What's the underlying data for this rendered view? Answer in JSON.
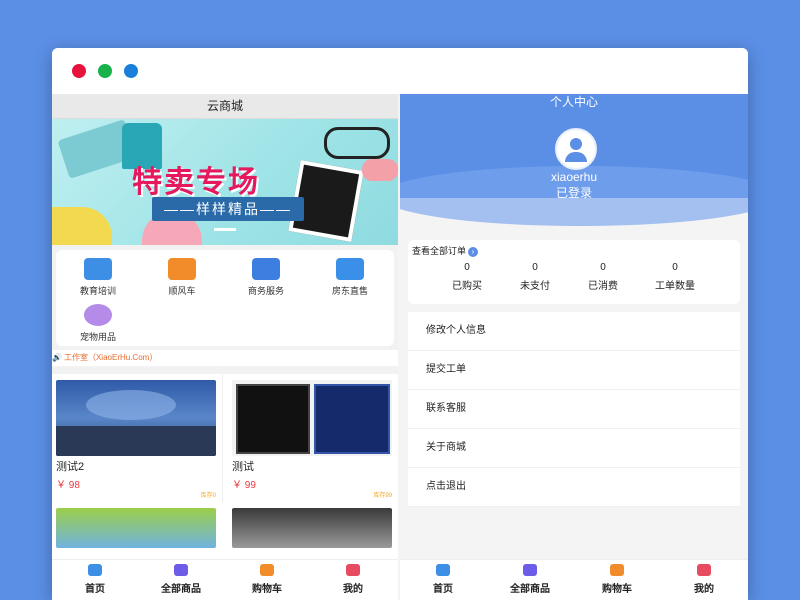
{
  "left": {
    "title": "云商城",
    "banner": {
      "title": "特卖专场",
      "subtitle": "——样样精品——"
    },
    "categories": [
      {
        "label": "教育培训",
        "icon": "education-icon",
        "color": "#3d8fe6"
      },
      {
        "label": "顺风车",
        "icon": "car-icon",
        "color": "#f28b2a"
      },
      {
        "label": "商务服务",
        "icon": "business-icon",
        "color": "#3d7fe0"
      },
      {
        "label": "房东直售",
        "icon": "house-icon",
        "color": "#3a8fe8"
      },
      {
        "label": "宠物用品",
        "icon": "paw-icon",
        "color": "#b48be8"
      }
    ],
    "notice": "工作室（XiaoErHu.Com）",
    "products": [
      {
        "name": "测试2",
        "price": "￥ 98",
        "stock": "库存0"
      },
      {
        "name": "测试",
        "price": "￥ 99",
        "stock": "库存99"
      }
    ]
  },
  "right": {
    "title": "个人中心",
    "username": "xiaoerhu",
    "status": "已登录",
    "orders_link": "查看全部订单",
    "stats": [
      {
        "value": "0",
        "label": "已购买"
      },
      {
        "value": "0",
        "label": "未支付"
      },
      {
        "value": "0",
        "label": "已消费"
      },
      {
        "value": "0",
        "label": "工单数量"
      }
    ],
    "menu": [
      "修改个人信息",
      "提交工单",
      "联系客服",
      "关于商城",
      "点击退出"
    ]
  },
  "tabs": [
    {
      "label": "首页",
      "icon": "home-icon",
      "color": "#3d8fe6"
    },
    {
      "label": "全部商品",
      "icon": "grid-icon",
      "color": "#6c5ce7"
    },
    {
      "label": "购物车",
      "icon": "cart-icon",
      "color": "#f28b2a"
    },
    {
      "label": "我的",
      "icon": "user-icon",
      "color": "#e84a5f"
    }
  ]
}
